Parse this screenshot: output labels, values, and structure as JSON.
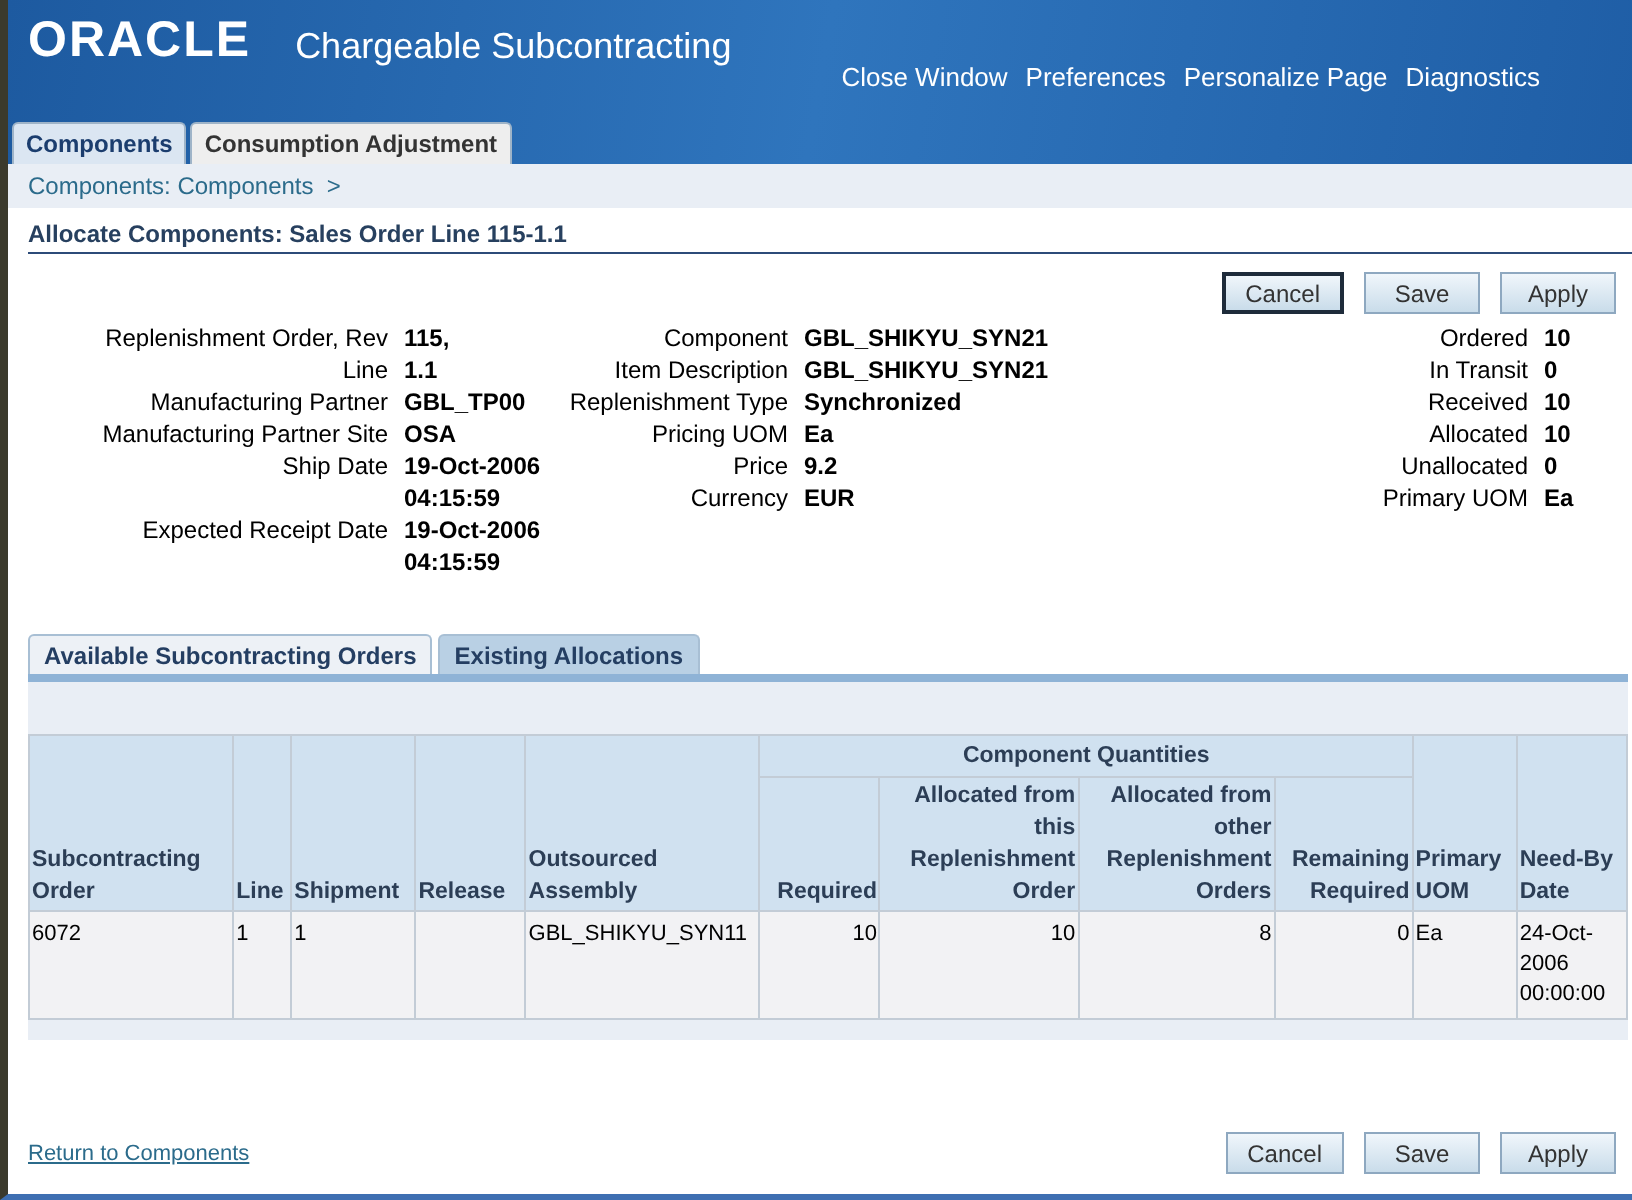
{
  "header": {
    "logo": "ORACLE",
    "title": "Chargeable Subcontracting",
    "links": [
      "Close Window",
      "Preferences",
      "Personalize Page",
      "Diagnostics"
    ]
  },
  "tabs": [
    {
      "label": "Components",
      "selected": true
    },
    {
      "label": "Consumption Adjustment",
      "selected": false
    }
  ],
  "breadcrumb": "Components: Components  >",
  "page_title": "Allocate Components: Sales Order Line 115-1.1",
  "top_buttons": [
    {
      "label": "Cancel",
      "focused": true
    },
    {
      "label": "Save",
      "focused": false
    },
    {
      "label": "Apply",
      "focused": false
    }
  ],
  "details": [
    [
      {
        "label": "Replenishment Order, Rev",
        "value": "115,"
      },
      {
        "label": "Line",
        "value": "1.1"
      },
      {
        "label": "Manufacturing Partner",
        "value": "GBL_TP00"
      },
      {
        "label": "Manufacturing Partner Site",
        "value": "OSA"
      },
      {
        "label": "Ship Date",
        "value": "19-Oct-2006 04:15:59"
      },
      {
        "label": "Expected Receipt Date",
        "value": "19-Oct-2006 04:15:59"
      }
    ],
    [
      {
        "label": "Component",
        "value": "GBL_SHIKYU_SYN21"
      },
      {
        "label": "Item Description",
        "value": "GBL_SHIKYU_SYN21"
      },
      {
        "label": "Replenishment Type",
        "value": "Synchronized"
      },
      {
        "label": "Pricing UOM",
        "value": "Ea"
      },
      {
        "label": "Price",
        "value": "9.2"
      },
      {
        "label": "Currency",
        "value": "EUR"
      }
    ],
    [
      {
        "label": "Ordered",
        "value": "10"
      },
      {
        "label": "In Transit",
        "value": "0"
      },
      {
        "label": "Received",
        "value": "10"
      },
      {
        "label": "Allocated",
        "value": "10"
      },
      {
        "label": "Unallocated",
        "value": "0"
      },
      {
        "label": "Primary UOM",
        "value": "Ea"
      }
    ]
  ],
  "sub_tabs": [
    {
      "label": "Available Subcontracting Orders",
      "selected": false
    },
    {
      "label": "Existing Allocations",
      "selected": true
    }
  ],
  "table": {
    "group_header": "Component Quantities",
    "columns": [
      {
        "label": "Subcontracting Order",
        "kind": "text",
        "grouped": false
      },
      {
        "label": "Line",
        "kind": "text",
        "grouped": false
      },
      {
        "label": "Shipment",
        "kind": "text",
        "grouped": false
      },
      {
        "label": "Release",
        "kind": "text",
        "grouped": false
      },
      {
        "label": "Outsourced Assembly",
        "kind": "text",
        "grouped": false
      },
      {
        "label": "Required",
        "kind": "number",
        "grouped": true
      },
      {
        "label": "Allocated from this Replenishment Order",
        "kind": "number",
        "grouped": true
      },
      {
        "label": "Allocated from other Replenishment Orders",
        "kind": "number",
        "grouped": true
      },
      {
        "label": "Remaining Required",
        "kind": "number",
        "grouped": true
      },
      {
        "label": "Primary UOM",
        "kind": "text",
        "grouped": false
      },
      {
        "label": "Need-By Date",
        "kind": "text",
        "grouped": false
      }
    ],
    "rows": [
      [
        "6072",
        "1",
        "1",
        "",
        "GBL_SHIKYU_SYN11",
        "10",
        "10",
        "8",
        "0",
        "Ea",
        "24-Oct-2006 00:00:00"
      ]
    ]
  },
  "return_link": "Return to Components",
  "bottom_buttons": [
    {
      "label": "Cancel",
      "focused": false
    },
    {
      "label": "Save",
      "focused": false
    },
    {
      "label": "Apply",
      "focused": false
    }
  ]
}
